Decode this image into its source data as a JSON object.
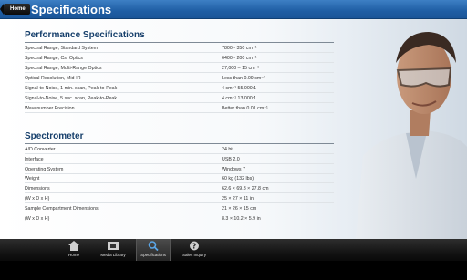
{
  "header": {
    "home_label": "Home",
    "title": "Specifications"
  },
  "performance": {
    "title": "Performance Specifications",
    "rows": [
      {
        "label": "Spectral Range, Standard System",
        "value": "7800 - 350 cm⁻¹"
      },
      {
        "label": "Spectral Range, CsI Optics",
        "value": "6400 - 200 cm⁻¹"
      },
      {
        "label": "Spectral Range, Multi-Range Optics",
        "value": "27,000 – 15 cm⁻¹"
      },
      {
        "label": "Optical Resolution, Mid-IR",
        "value": "Less than 0.09 cm⁻¹"
      },
      {
        "label": "Signal-to-Noise, 1 min. scan, Peak-to-Peak",
        "value": "4 cm⁻¹ 55,000:1"
      },
      {
        "label": "Signal-to-Noise, 5 sec. scan, Peak-to-Peak",
        "value": "4 cm⁻¹ 13,000:1"
      },
      {
        "label": "Wavenumber Precision",
        "value": "Better than 0.01 cm⁻¹"
      }
    ]
  },
  "spectrometer": {
    "title": "Spectrometer",
    "rows": [
      {
        "label": "A/D Converter",
        "value": "24 bit"
      },
      {
        "label": "Interface",
        "value": "USB 2.0"
      },
      {
        "label": "Operating System",
        "value": "Windows 7"
      },
      {
        "label": "Weight",
        "value": "60 kg (132 lbs)"
      },
      {
        "label": "Dimensions",
        "value": "62.6 × 69.8 × 27.8 cm"
      },
      {
        "label": "(W x D x H)",
        "value": "25 × 27 × 11 in"
      },
      {
        "label": "Sample Compartment Dimensions",
        "value": "21 × 26 × 15 cm"
      },
      {
        "label": "(W x D x H)",
        "value": "8.3 × 10.2 × 5.9 in"
      }
    ]
  },
  "navbar": {
    "items": [
      {
        "label": "Home",
        "icon": "house-icon"
      },
      {
        "label": "Media Library",
        "icon": "film-icon"
      },
      {
        "label": "Specifications",
        "icon": "magnifier-icon",
        "active": true
      },
      {
        "label": "Sales Inquiry",
        "icon": "question-icon"
      }
    ]
  },
  "colors": {
    "header_blue": "#1f5ea4",
    "section_title": "#163f6b",
    "nav_bg": "#111111"
  }
}
